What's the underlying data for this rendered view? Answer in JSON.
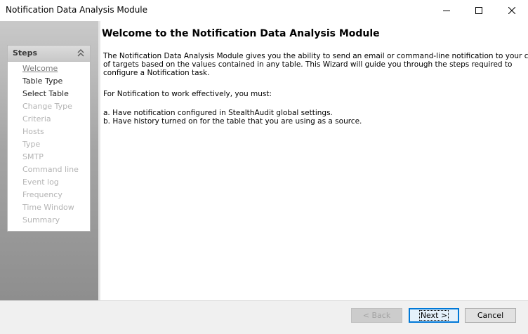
{
  "window": {
    "title": "Notification Data Analysis Module"
  },
  "steps_panel": {
    "header": "Steps",
    "items": [
      {
        "label": "Welcome",
        "state": "current"
      },
      {
        "label": "Table Type",
        "state": "enabled"
      },
      {
        "label": "Select Table",
        "state": "enabled"
      },
      {
        "label": "Change Type",
        "state": "disabled"
      },
      {
        "label": "Criteria",
        "state": "disabled"
      },
      {
        "label": "Hosts",
        "state": "disabled"
      },
      {
        "label": "Type",
        "state": "disabled"
      },
      {
        "label": "SMTP",
        "state": "disabled"
      },
      {
        "label": "Command line",
        "state": "disabled"
      },
      {
        "label": "Event log",
        "state": "disabled"
      },
      {
        "label": "Frequency",
        "state": "disabled"
      },
      {
        "label": "Time Window",
        "state": "disabled"
      },
      {
        "label": "Summary",
        "state": "disabled"
      }
    ]
  },
  "content": {
    "heading": "Welcome to the Notification Data Analysis Module",
    "intro": [
      "The Notification Data Analysis Module gives you the ability to send an email or command-line notification to your choice",
      "of targets based on the values contained in any table. This Wizard will guide you through the steps required to",
      "configure a Notification task."
    ],
    "requirements_lead": "For Notification to work effectively, you must:",
    "requirements": [
      "a. Have notification configured in StealthAudit global settings.",
      "b. Have history turned on for the table that you are using as a source."
    ]
  },
  "buttons": {
    "back": "< Back",
    "next": "Next >",
    "cancel": "Cancel"
  },
  "icons": {
    "minimize": "minimize-icon",
    "maximize": "maximize-icon",
    "close": "close-icon",
    "collapse": "double-chevron-up-icon"
  }
}
